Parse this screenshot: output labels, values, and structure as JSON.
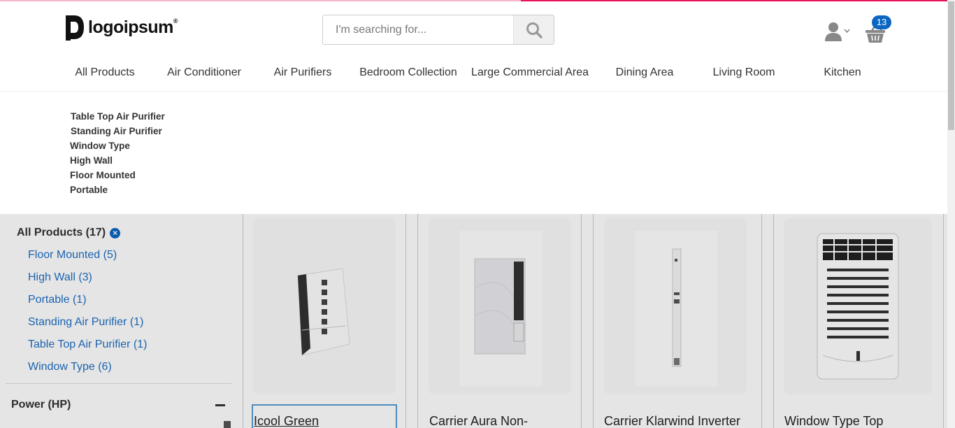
{
  "header": {
    "logo_text": "logoipsum",
    "logo_mark": "®",
    "search_placeholder": "I'm searching for...",
    "cart_count": "13",
    "load_progress_percent": 45
  },
  "nav": {
    "items": [
      {
        "label": "All Products"
      },
      {
        "label": "Air Conditioner"
      },
      {
        "label": "Air Purifiers"
      },
      {
        "label": "Bedroom Collection"
      },
      {
        "label": "Large Commercial Area"
      },
      {
        "label": "Dining Area"
      },
      {
        "label": "Living Room"
      },
      {
        "label": "Kitchen"
      }
    ]
  },
  "dropdown": {
    "items": [
      {
        "label": "Table Top Air Purifier"
      },
      {
        "label": "Standing Air Purifier"
      },
      {
        "label": "Window Type"
      },
      {
        "label": "High Wall"
      },
      {
        "label": "Floor Mounted"
      },
      {
        "label": "Portable"
      }
    ]
  },
  "sidebar": {
    "all_products": "All Products (17)",
    "options": [
      {
        "label": "Floor Mounted (5)"
      },
      {
        "label": "High Wall (3)"
      },
      {
        "label": "Portable (1)"
      },
      {
        "label": "Standing Air Purifier (1)"
      },
      {
        "label": "Table Top Air Purifier (1)"
      },
      {
        "label": "Window Type (6)"
      }
    ],
    "power_title": "Power (HP)"
  },
  "products": [
    {
      "title": "Icool Green"
    },
    {
      "title": "Carrier Aura Non-"
    },
    {
      "title": "Carrier Klarwind Inverter"
    },
    {
      "title": "Window Type Top"
    }
  ],
  "colors": {
    "accent": "#e8135a",
    "badge": "#0a66c2",
    "link": "#1f6fc5"
  },
  "icons": {
    "search": "search-icon",
    "user": "user-icon",
    "cart": "basket-icon",
    "clear": "close-circle-icon",
    "collapse": "minus-icon"
  }
}
